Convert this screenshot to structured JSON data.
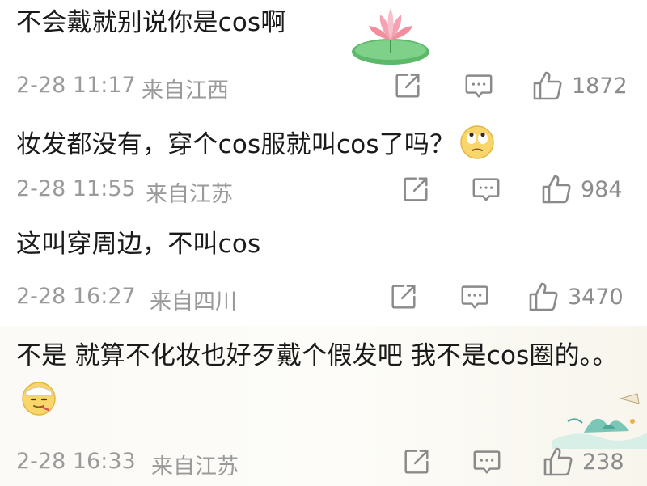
{
  "comments": [
    {
      "text": "不会戴就别说你是cos啊",
      "date": "2-28 11:17",
      "origin": "来自江西",
      "likes": "1872"
    },
    {
      "text": "妆发都没有，穿个cos服就叫cos了吗？",
      "date": "2-28 11:55",
      "origin": "来自江苏",
      "likes": "984"
    },
    {
      "text": "这叫穿周边，不叫cos",
      "date": "2-28 16:27",
      "origin": "来自四川",
      "likes": "3470"
    },
    {
      "text": "不是 就算不化妆也好歹戴个假发吧 我不是cos圈的。。",
      "date": "2-28 16:33",
      "origin": "来自江苏",
      "likes": "238"
    }
  ],
  "icons": {
    "repost": "repost-icon",
    "comment": "comment-icon",
    "like": "thumbs-up-icon",
    "emoji_roll_eyes": "eye-roll-emoji-icon",
    "emoji_sick": "sick-emoji-icon",
    "sticker_lotus": "lotus-sticker-icon",
    "sticker_landscape": "landscape-sticker-icon"
  },
  "colors": {
    "text": "#1a1a1a",
    "meta": "#9a9a9a",
    "icon": "#8c8c8c"
  }
}
